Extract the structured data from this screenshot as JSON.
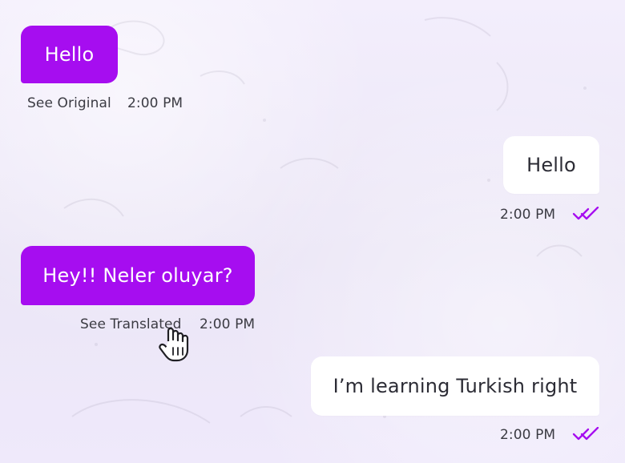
{
  "messages": [
    {
      "id": "m1",
      "direction": "incoming",
      "text": "Hello",
      "action_label": "See Original",
      "time": "2:00 PM"
    },
    {
      "id": "m2",
      "direction": "outgoing",
      "text": "Hello",
      "time": "2:00 PM",
      "status": "read-check-icon"
    },
    {
      "id": "m3",
      "direction": "incoming",
      "text": "Hey!! Neler oluyar?",
      "action_label": "See Translated",
      "time": "2:00 PM"
    },
    {
      "id": "m4",
      "direction": "outgoing",
      "text": "I’m learning Turkish right",
      "time": "2:00 PM",
      "status": "read-check-icon"
    }
  ],
  "colors": {
    "incoming_bubble": "#a60df0",
    "outgoing_bubble": "#ffffff",
    "check": "#a60df0",
    "meta_text": "#3b3b43"
  },
  "icons": {
    "cursor": "hand-pointer-icon",
    "read_status": "double-check-icon"
  }
}
